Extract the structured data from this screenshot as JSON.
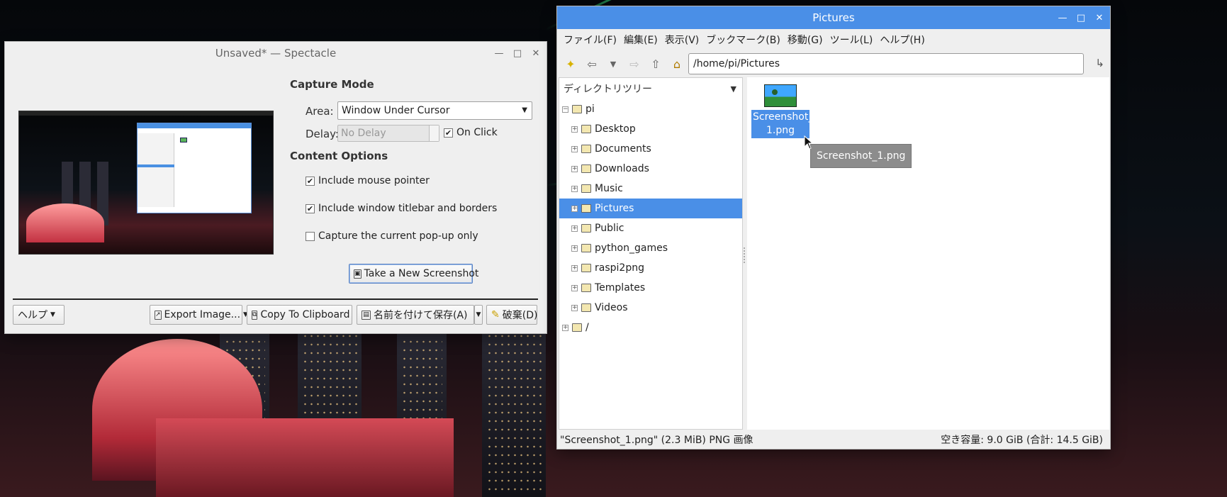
{
  "spectacle": {
    "title": "Unsaved* — Spectacle",
    "capture_mode_heading": "Capture Mode",
    "area_label": "Area:",
    "area_value": "Window Under Cursor",
    "delay_label": "Delay:",
    "delay_value": "No Delay",
    "on_click_label": "On Click",
    "on_click_checked": true,
    "content_options_heading": "Content Options",
    "options": [
      {
        "label": "Include mouse pointer",
        "checked": true
      },
      {
        "label": "Include window titlebar and borders",
        "checked": true
      },
      {
        "label": "Capture the current pop-up only",
        "checked": false
      }
    ],
    "take_screenshot_label": "Take a New Screenshot",
    "help_label": "ヘルプ",
    "export_label": "Export Image...",
    "copy_label": "Copy To Clipboard",
    "save_as_label": "名前を付けて保存(A)",
    "discard_label": "破棄(D)"
  },
  "filemanager": {
    "title": "Pictures",
    "menu": [
      "ファイル(F)",
      "編集(E)",
      "表示(V)",
      "ブックマーク(B)",
      "移動(G)",
      "ツール(L)",
      "ヘルプ(H)"
    ],
    "path": "/home/pi/Pictures",
    "sidebar_heading": "ディレクトリツリー",
    "tree": [
      {
        "label": "pi",
        "level": 0,
        "selected": false
      },
      {
        "label": "Desktop",
        "level": 1,
        "selected": false
      },
      {
        "label": "Documents",
        "level": 1,
        "selected": false
      },
      {
        "label": "Downloads",
        "level": 1,
        "selected": false
      },
      {
        "label": "Music",
        "level": 1,
        "selected": false
      },
      {
        "label": "Pictures",
        "level": 1,
        "selected": true
      },
      {
        "label": "Public",
        "level": 1,
        "selected": false
      },
      {
        "label": "python_games",
        "level": 1,
        "selected": false
      },
      {
        "label": "raspi2png",
        "level": 1,
        "selected": false
      },
      {
        "label": "Templates",
        "level": 1,
        "selected": false
      },
      {
        "label": "Videos",
        "level": 1,
        "selected": false
      },
      {
        "label": "/",
        "level": 0,
        "selected": false
      }
    ],
    "file_name_line1": "Screenshot_",
    "file_name_line2": "1.png",
    "tooltip": "Screenshot_1.png",
    "status_left": "\"Screenshot_1.png\" (2.3 MiB) PNG 画像",
    "status_right": "空き容量: 9.0 GiB (合計: 14.5 GiB)"
  },
  "colors": {
    "titlebar_active": "#4a8fe7",
    "selection": "#4a8fe7"
  }
}
